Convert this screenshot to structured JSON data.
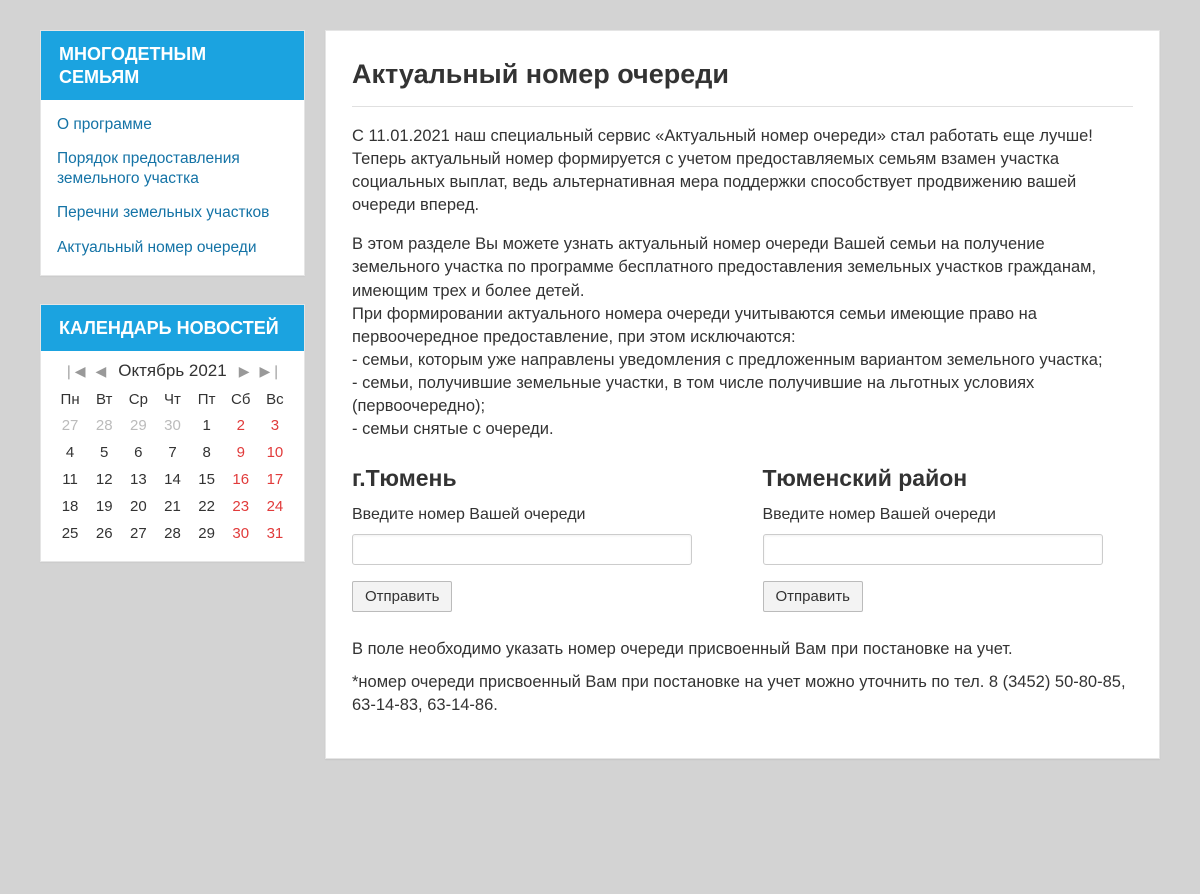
{
  "sidebar": {
    "title": "МНОГОДЕТНЫМ СЕМЬЯМ",
    "items": [
      {
        "label": "О программе"
      },
      {
        "label": "Порядок предоставления земельного участка"
      },
      {
        "label": "Перечни земельных участков"
      },
      {
        "label": "Актуальный номер очереди"
      }
    ]
  },
  "calendar": {
    "title": "КАЛЕНДАРЬ НОВОСТЕЙ",
    "month_label": "Октябрь 2021",
    "weekdays": [
      "Пн",
      "Вт",
      "Ср",
      "Чт",
      "Пт",
      "Сб",
      "Вс"
    ],
    "rows": [
      [
        {
          "d": "27",
          "cls": "other"
        },
        {
          "d": "28",
          "cls": "other"
        },
        {
          "d": "29",
          "cls": "other"
        },
        {
          "d": "30",
          "cls": "other"
        },
        {
          "d": "1",
          "cls": ""
        },
        {
          "d": "2",
          "cls": "weekend"
        },
        {
          "d": "3",
          "cls": "weekend"
        }
      ],
      [
        {
          "d": "4",
          "cls": ""
        },
        {
          "d": "5",
          "cls": ""
        },
        {
          "d": "6",
          "cls": ""
        },
        {
          "d": "7",
          "cls": ""
        },
        {
          "d": "8",
          "cls": ""
        },
        {
          "d": "9",
          "cls": "weekend"
        },
        {
          "d": "10",
          "cls": "weekend"
        }
      ],
      [
        {
          "d": "11",
          "cls": ""
        },
        {
          "d": "12",
          "cls": ""
        },
        {
          "d": "13",
          "cls": ""
        },
        {
          "d": "14",
          "cls": ""
        },
        {
          "d": "15",
          "cls": ""
        },
        {
          "d": "16",
          "cls": "weekend"
        },
        {
          "d": "17",
          "cls": "weekend"
        }
      ],
      [
        {
          "d": "18",
          "cls": ""
        },
        {
          "d": "19",
          "cls": ""
        },
        {
          "d": "20",
          "cls": ""
        },
        {
          "d": "21",
          "cls": ""
        },
        {
          "d": "22",
          "cls": ""
        },
        {
          "d": "23",
          "cls": "weekend"
        },
        {
          "d": "24",
          "cls": "weekend"
        }
      ],
      [
        {
          "d": "25",
          "cls": ""
        },
        {
          "d": "26",
          "cls": ""
        },
        {
          "d": "27",
          "cls": ""
        },
        {
          "d": "28",
          "cls": ""
        },
        {
          "d": "29",
          "cls": ""
        },
        {
          "d": "30",
          "cls": "weekend"
        },
        {
          "d": "31",
          "cls": "weekend"
        }
      ]
    ]
  },
  "main": {
    "title": "Актуальный номер очереди",
    "para1": "С 11.01.2021 наш специальный сервис «Актуальный номер очереди» стал работать еще лучше! Теперь актуальный номер формируется с учетом предоставляемых семьям взамен участка социальных выплат, ведь альтернативная мера поддержки способствует продвижению вашей очереди вперед.",
    "para2": "В этом разделе Вы можете узнать актуальный номер очереди Вашей семьи на получение земельного участка по программе бесплатного предоставления земельных участков гражданам, имеющим трех и более детей.\nПри формировании актуального номера очереди учитываются семьи имеющие право на первоочередное предоставление, при этом исключаются:\n- семьи, которым уже направлены уведомления с предложенным вариантом земельного участка;\n- семьи, получившие земельные участки, в том числе получившие на льготных условиях (первоочередно);\n- семьи снятые с очереди.",
    "form1": {
      "heading": "г.Тюмень",
      "label": "Введите номер Вашей очереди",
      "submit": "Отправить"
    },
    "form2": {
      "heading": "Тюменский район",
      "label": "Введите номер Вашей очереди",
      "submit": "Отправить"
    },
    "foot1": " В поле необходимо указать номер очереди присвоенный Вам при постановке на учет.",
    "foot2": "*номер очереди присвоенный Вам при постановке на учет можно уточнить по тел. 8 (3452) 50-80-85, 63-14-83, 63-14-86."
  }
}
